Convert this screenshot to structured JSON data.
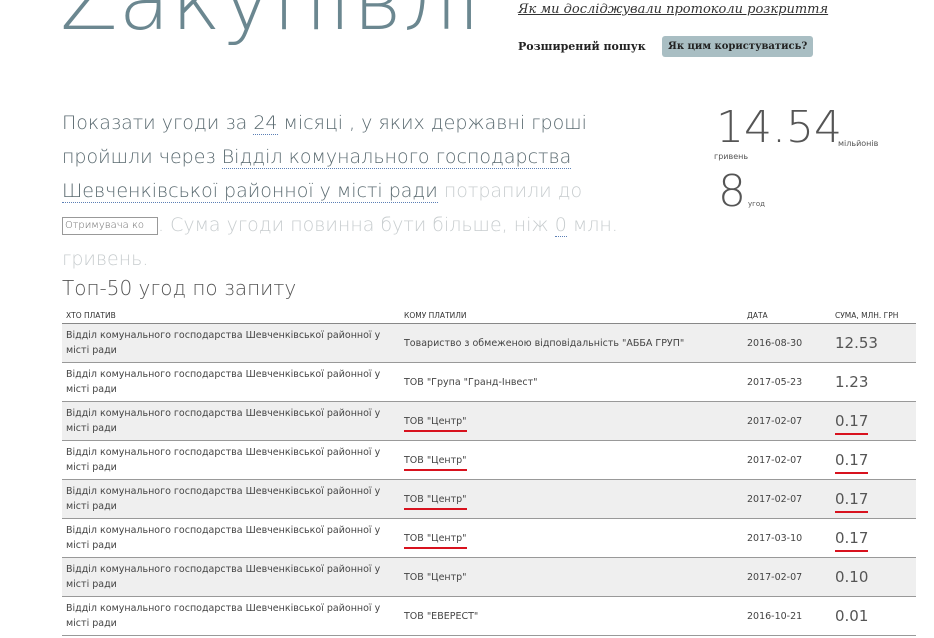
{
  "header": {
    "title": "Zакупівлі",
    "research_link": "Як ми досліджували протоколи розкриття",
    "advanced_search": "Розширений пошук",
    "howto_button": "Як цим користуватись?"
  },
  "query": {
    "part1": "Показати угоди за ",
    "months": "24",
    "part2": " місяці , у яких державні гроші пройшли через ",
    "payer": "Відділ комунального господарства Шевченківської районної у місті ради",
    "part3": " потрапили до ",
    "recipient_placeholder": "Отримувача ко",
    "part4": ". Сума угоди повинна бути більше, ніж ",
    "min_amount": "0",
    "part5": " млн. гривень."
  },
  "stats": {
    "sum": "14.54",
    "sum_unit": "мільйонів",
    "currency": "гривень",
    "count": "8",
    "count_unit": "угод"
  },
  "table": {
    "title": "Топ-50 угод по запиту",
    "columns": [
      "ХТО ПЛАТИВ",
      "КОМУ ПЛАТИЛИ",
      "ДАТА",
      "СУМА, МЛН. ГРН"
    ],
    "rows": [
      {
        "payer": "Відділ комунального господарства Шевченківської районної у місті ради",
        "recipient": "Товариство з обмеженою відповідальність \"АББА ГРУП\"",
        "date": "2016-08-30",
        "amount": "12.53",
        "highlight": false
      },
      {
        "payer": "Відділ комунального господарства Шевченківської районної у місті ради",
        "recipient": "ТОВ \"Група \"Гранд-Інвест\"",
        "date": "2017-05-23",
        "amount": "1.23",
        "highlight": false
      },
      {
        "payer": "Відділ комунального господарства Шевченківської районної у місті ради",
        "recipient": "ТОВ \"Центр\"",
        "date": "2017-02-07",
        "amount": "0.17",
        "highlight": true
      },
      {
        "payer": "Відділ комунального господарства Шевченківської районної у місті ради",
        "recipient": "ТОВ \"Центр\"",
        "date": "2017-02-07",
        "amount": "0.17",
        "highlight": true
      },
      {
        "payer": "Відділ комунального господарства Шевченківської районної у місті ради",
        "recipient": "ТОВ \"Центр\"",
        "date": "2017-02-07",
        "amount": "0.17",
        "highlight": true
      },
      {
        "payer": "Відділ комунального господарства Шевченківської районної у місті ради",
        "recipient": "ТОВ \"Центр\"",
        "date": "2017-03-10",
        "amount": "0.17",
        "highlight": true
      },
      {
        "payer": "Відділ комунального господарства Шевченківської районної у місті ради",
        "recipient": "ТОВ \"Центр\"",
        "date": "2017-02-07",
        "amount": "0.10",
        "highlight": false
      },
      {
        "payer": "Відділ комунального господарства Шевченківської районної у місті ради",
        "recipient": "ТОВ \"ЕВЕРЕСТ\"",
        "date": "2016-10-21",
        "amount": "0.01",
        "highlight": false
      }
    ]
  },
  "colors": {
    "title": "#6b8790",
    "highlight_underline": "#d8121e",
    "button_bg": "#a9bec3",
    "row_alt": "#efefef"
  }
}
